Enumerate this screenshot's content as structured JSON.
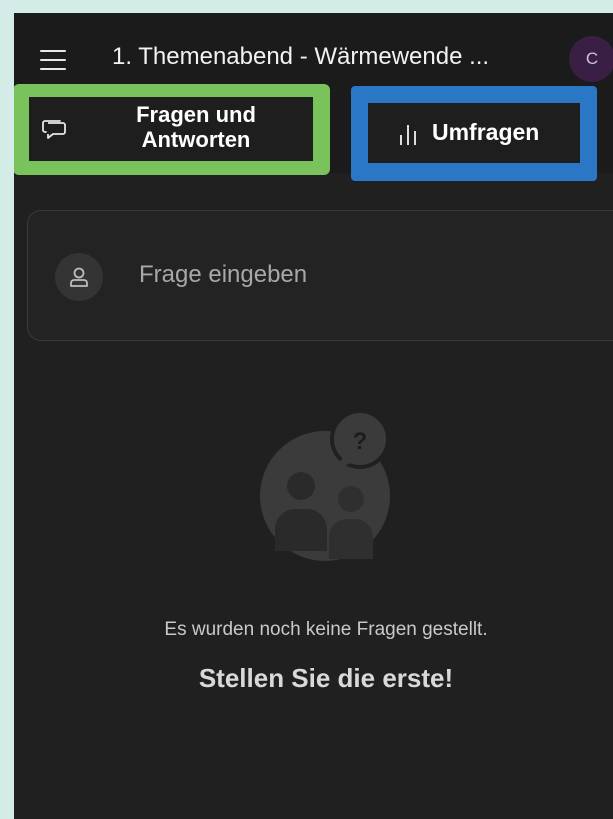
{
  "header": {
    "menu_icon": "hamburger-icon",
    "title": "1. Themenabend - Wärmewende ...",
    "avatar_initial": "C",
    "avatar_color": "#3a1f45"
  },
  "tabs": [
    {
      "label": "Fragen und Antworten",
      "icon": "speech-bubble-icon",
      "highlight_color": "#79c25c"
    },
    {
      "label": "Umfragen",
      "icon": "bar-chart-icon",
      "highlight_color": "#2a77c6"
    }
  ],
  "question_input": {
    "placeholder": "Frage eingeben",
    "icon": "user-icon"
  },
  "empty_state": {
    "illustration": "people-question-icon",
    "message": "Es wurden noch keine Fragen gestellt.",
    "call_to_action": "Stellen Sie die erste!"
  }
}
